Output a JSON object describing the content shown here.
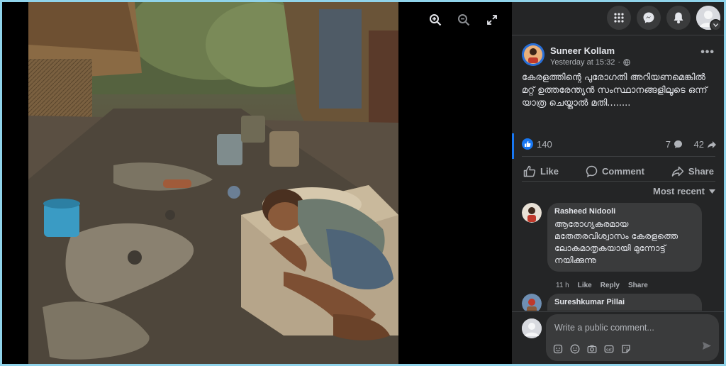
{
  "viewer": {
    "tools": [
      "zoom-in-icon",
      "zoom-out-icon",
      "fullscreen-icon"
    ]
  },
  "topbar": {
    "icons": [
      "menu-grid-icon",
      "messenger-icon",
      "notifications-bell-icon",
      "profile-avatar"
    ]
  },
  "post": {
    "author": "Suneer Kollam",
    "time": "Yesterday at 15:32",
    "audience_icon": "globe-icon",
    "text": "കേരളത്തിന്റെ പുരോഗതി അറിയണമെങ്കിൽ മറ്റ് ഉത്തരേന്ത്യൻ സംസ്ഥാനങ്ങളിലൂടെ ഒന്ന് യാത്ര ചെയ്താൽ മതി........",
    "reactions": "140",
    "comments": "7",
    "shares": "42"
  },
  "actions": {
    "like": "Like",
    "comment": "Comment",
    "share": "Share"
  },
  "sort": {
    "label": "Most recent"
  },
  "comments": [
    {
      "name": "Rasheed Nidooli",
      "text": "ആരോഗ്യകരമായ മതേതരവിശ്വാസം കേരളത്തെ ലോകമാതൃകയായി മുന്നോട്ട് നയിക്കുന്നു",
      "time": "11 h",
      "like": "Like",
      "reply": "Reply",
      "share": "Share"
    },
    {
      "name": "Sureshkumar Pillai",
      "text": ""
    }
  ],
  "composer": {
    "placeholder": "Write a public comment...",
    "icons": [
      "sticker-icon",
      "emoji-icon",
      "camera-icon",
      "gif-icon",
      "avatar-sticker-icon"
    ],
    "send_icon": "send-icon"
  },
  "colors": {
    "accent": "#1877f2",
    "panel": "#242526",
    "bubble": "#3a3b3c",
    "text": "#e4e6eb",
    "muted": "#b0b3b8",
    "border": "#8fd3ea"
  }
}
